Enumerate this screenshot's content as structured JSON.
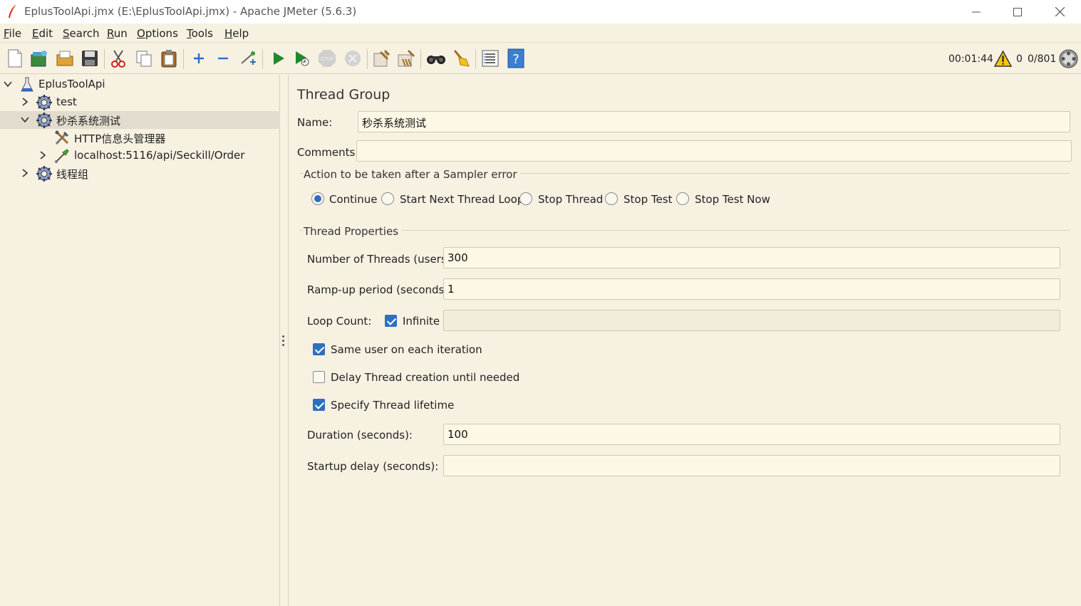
{
  "window": {
    "title": "EplusToolApi.jmx (E:\\EplusToolApi.jmx) - Apache JMeter (5.6.3)"
  },
  "menu": [
    {
      "first": "F",
      "rest": "ile"
    },
    {
      "first": "E",
      "rest": "dit"
    },
    {
      "first": "S",
      "rest": "earch"
    },
    {
      "first": "R",
      "rest": "un"
    },
    {
      "first": "O",
      "rest": "ptions"
    },
    {
      "first": "T",
      "rest": "ools"
    },
    {
      "first": "H",
      "rest": "elp"
    }
  ],
  "toolbar_icons": [
    "new-icon",
    "templates-icon",
    "open-icon",
    "save-icon",
    "cut-icon",
    "copy-icon",
    "paste-icon",
    "expand-icon",
    "collapse-icon",
    "toggle-icon",
    "start-icon",
    "start-no-pause-icon",
    "stop-icon",
    "shutdown-icon",
    "clear-icon",
    "clear-all-icon",
    "search-icon",
    "reset-search-icon",
    "function-helper-icon",
    "help-icon"
  ],
  "status": {
    "elapsed": "00:01:44",
    "warnings": "0",
    "threads": "0/801"
  },
  "tree": [
    {
      "label": "EplusToolApi",
      "icon": "test-plan-icon",
      "level": 0,
      "expanded": true
    },
    {
      "label": "test",
      "icon": "thread-group-icon",
      "level": 1,
      "expanded": false
    },
    {
      "label": "秒杀系统测试",
      "icon": "thread-group-icon",
      "level": 1,
      "expanded": true,
      "selected": true
    },
    {
      "label": "HTTP信息头管理器",
      "icon": "config-element-icon",
      "level": 2
    },
    {
      "label": "localhost:5116/api/Seckill/Order",
      "icon": "sampler-icon",
      "level": 2,
      "expanded": false
    },
    {
      "label": "线程组",
      "icon": "thread-group-icon",
      "level": 1,
      "expanded": false
    }
  ],
  "panel": {
    "title": "Thread Group",
    "name_label": "Name:",
    "name_value": "秒杀系统测试",
    "comments_label": "Comments:",
    "comments_value": "",
    "sampler_error": {
      "title": "Action to be taken after a Sampler error",
      "options": [
        "Continue",
        "Start Next Thread Loop",
        "Stop Thread",
        "Stop Test",
        "Stop Test Now"
      ],
      "selected": "Continue"
    },
    "thread_props": {
      "title": "Thread Properties",
      "threads_label": "Number of Threads (users):",
      "threads_value": "300",
      "rampup_label": "Ramp-up period (seconds):",
      "rampup_value": "1",
      "loop_label": "Loop Count:",
      "infinite_label": "Infinite",
      "infinite_checked": true,
      "loop_value": "",
      "same_user_label": "Same user on each iteration",
      "same_user_checked": true,
      "delay_label": "Delay Thread creation until needed",
      "delay_checked": false,
      "lifetime_label": "Specify Thread lifetime",
      "lifetime_checked": true,
      "duration_label": "Duration (seconds):",
      "duration_value": "100",
      "startup_label": "Startup delay (seconds):",
      "startup_value": ""
    }
  },
  "colors": {
    "background": "#f7f1e2",
    "field": "#fdf7e6",
    "selection": "#e1dccd",
    "accent": "#2f6fc1"
  }
}
